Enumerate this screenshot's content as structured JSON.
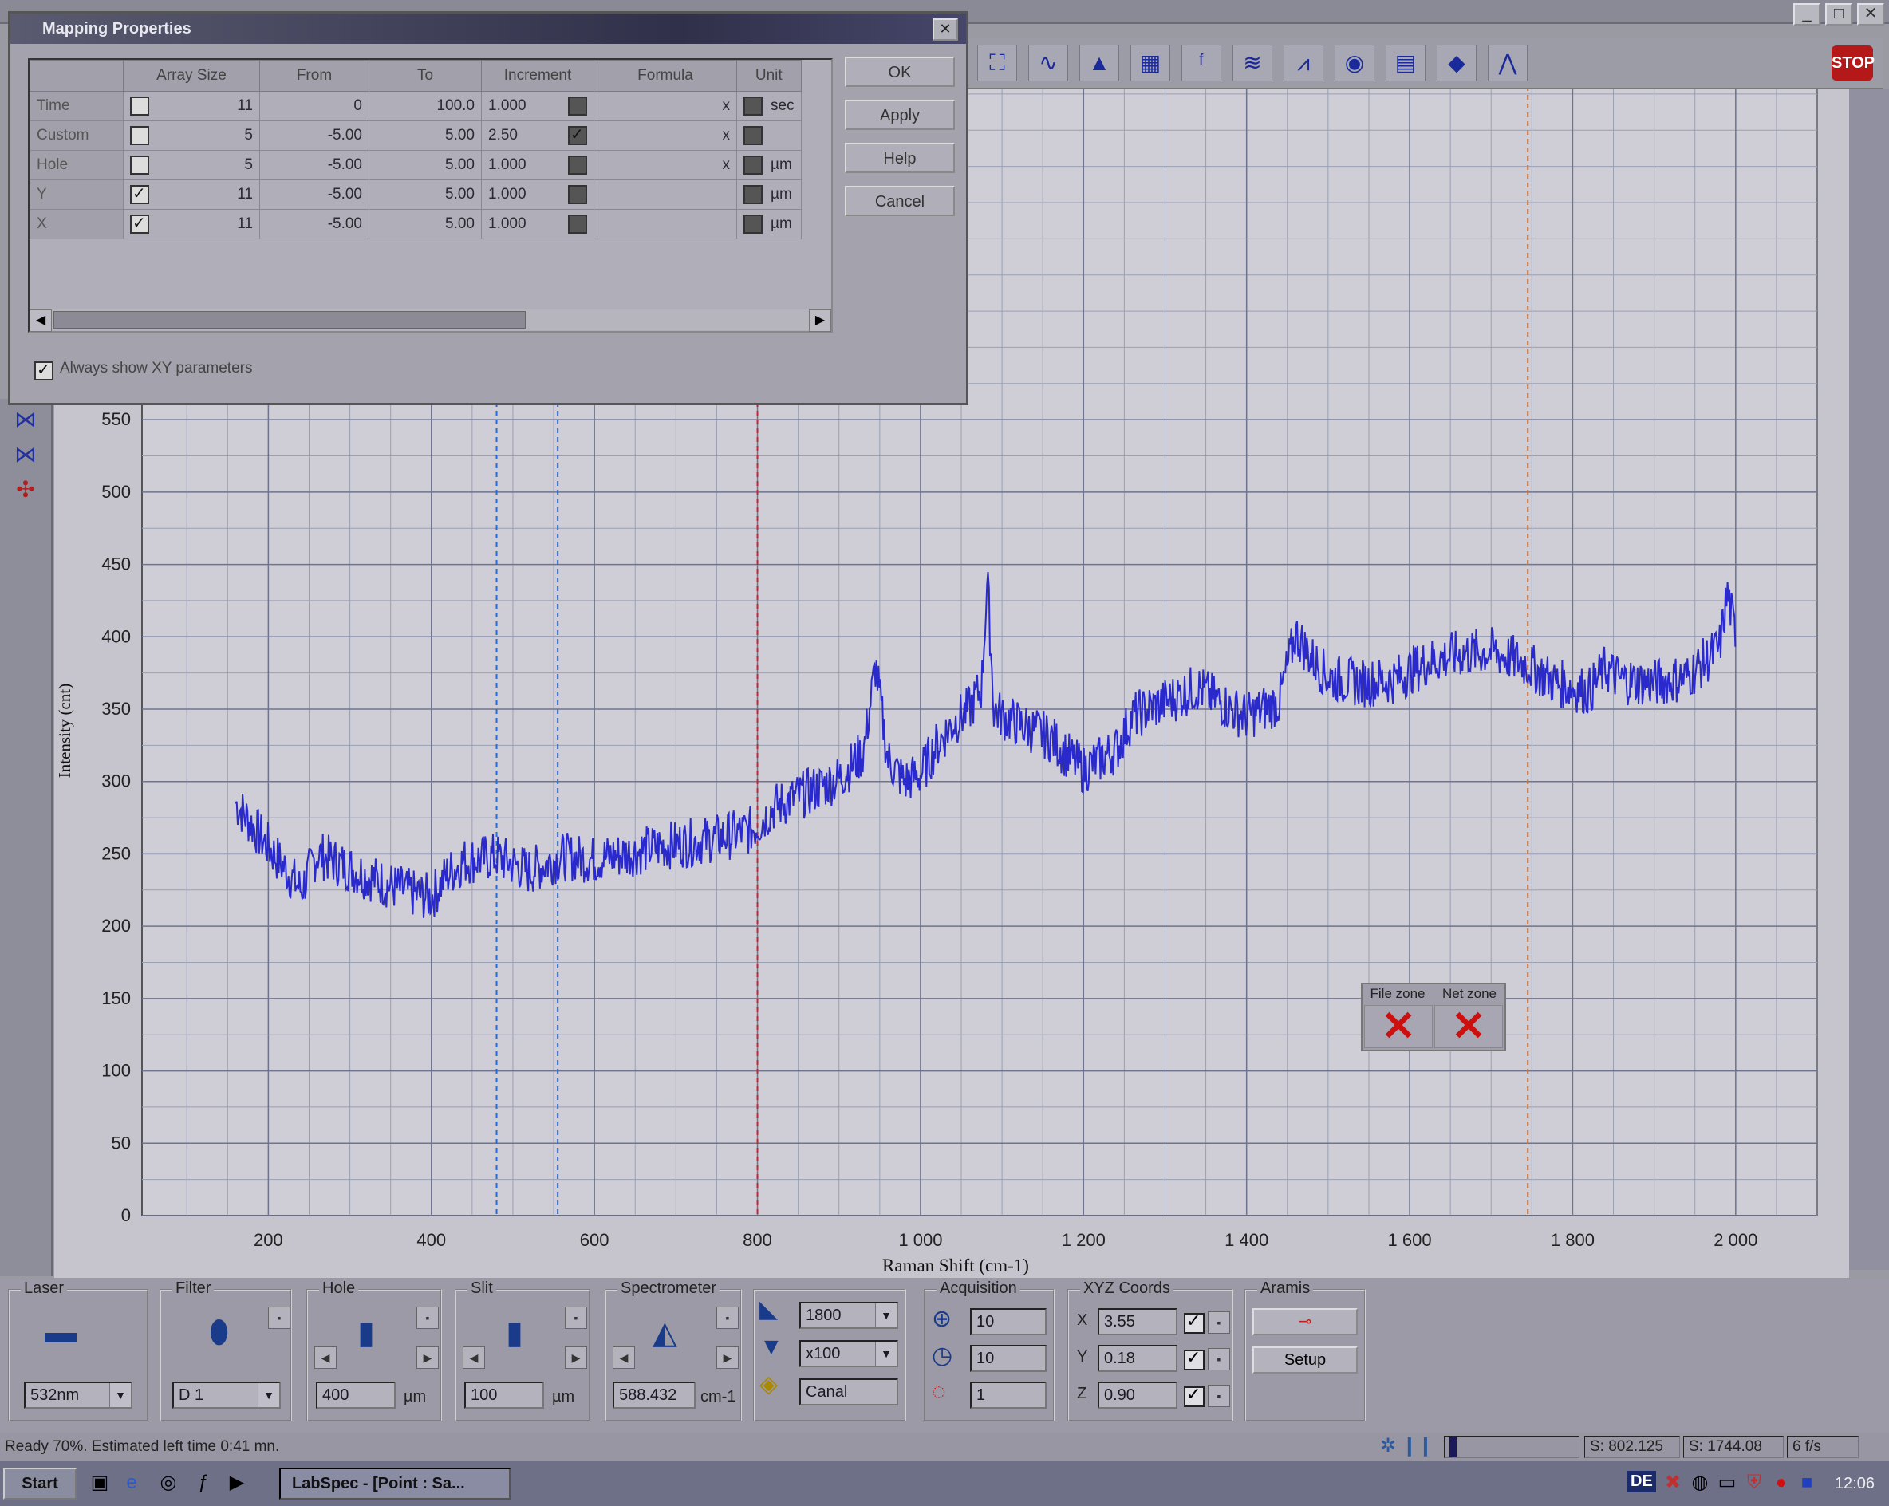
{
  "window": {
    "min": "_",
    "max": "□",
    "close": "✕"
  },
  "dialog": {
    "title": "Mapping Properties",
    "close": "✕",
    "columns": [
      "",
      "Array Size",
      "From",
      "To",
      "Increment",
      "Formula",
      "Unit"
    ],
    "rows": [
      {
        "name": "Time",
        "checked": false,
        "size": "11",
        "from": "0",
        "to": "100.0",
        "inc": "1.000",
        "inc_checked": false,
        "x": "x",
        "unit": "sec"
      },
      {
        "name": "Custom",
        "checked": false,
        "size": "5",
        "from": "-5.00",
        "to": "5.00",
        "inc": "2.50",
        "inc_checked": true,
        "x": "x",
        "unit": ""
      },
      {
        "name": "Hole",
        "checked": false,
        "size": "5",
        "from": "-5.00",
        "to": "5.00",
        "inc": "1.000",
        "inc_checked": false,
        "x": "x",
        "unit": "µm"
      },
      {
        "name": "Y",
        "checked": true,
        "size": "11",
        "from": "-5.00",
        "to": "5.00",
        "inc": "1.000",
        "inc_checked": false,
        "x": "",
        "unit": "µm"
      },
      {
        "name": "X",
        "checked": true,
        "size": "11",
        "from": "-5.00",
        "to": "5.00",
        "inc": "1.000",
        "inc_checked": false,
        "x": "",
        "unit": "µm"
      }
    ],
    "buttons": {
      "ok": "OK",
      "apply": "Apply",
      "help": "Help",
      "cancel": "Cancel"
    },
    "always_show": "Always show XY parameters"
  },
  "toolbar": {
    "stop": "STOP"
  },
  "chart_data": {
    "type": "line",
    "xlabel": "Raman Shift (cm-1)",
    "ylabel": "Intensity (cnt)",
    "xlim": [
      45,
      2100
    ],
    "ylim": [
      0,
      560
    ],
    "xticks": [
      200,
      400,
      600,
      800,
      1000,
      1200,
      1400,
      1600,
      1800,
      2000
    ],
    "xtick_labels": [
      "200",
      "400",
      "600",
      "800",
      "1 000",
      "1 200",
      "1 400",
      "1 600",
      "1 800",
      "2 000"
    ],
    "yticks": [
      0,
      50,
      100,
      150,
      200,
      250,
      300,
      350,
      400,
      450,
      500,
      550
    ],
    "grid": true,
    "markers": {
      "blue": [
        480,
        555
      ],
      "red": [
        800
      ],
      "orange": [
        1745
      ]
    },
    "series": [
      {
        "color": "#2a2acc",
        "x": [
          160,
          180,
          200,
          220,
          240,
          260,
          300,
          340,
          380,
          400,
          420,
          440,
          480,
          520,
          560,
          600,
          640,
          680,
          720,
          760,
          790,
          800,
          820,
          860,
          900,
          930,
          945,
          960,
          980,
          1000,
          1020,
          1040,
          1060,
          1075,
          1082,
          1090,
          1100,
          1120,
          1160,
          1180,
          1200,
          1240,
          1260,
          1300,
          1340,
          1380,
          1400,
          1440,
          1460,
          1480,
          1500,
          1540,
          1580,
          1620,
          1660,
          1700,
          1740,
          1780,
          1820,
          1840,
          1860,
          1900,
          1940,
          1960,
          1980,
          1990,
          2000
        ],
        "y": [
          285,
          270,
          255,
          240,
          225,
          250,
          240,
          230,
          222,
          220,
          236,
          245,
          248,
          238,
          248,
          246,
          250,
          255,
          258,
          262,
          266,
          270,
          282,
          292,
          302,
          320,
          380,
          315,
          300,
          305,
          325,
          340,
          350,
          365,
          440,
          350,
          345,
          340,
          330,
          318,
          308,
          322,
          345,
          355,
          365,
          350,
          345,
          355,
          402,
          385,
          372,
          368,
          370,
          382,
          388,
          390,
          382,
          368,
          362,
          378,
          370,
          368,
          372,
          382,
          392,
          430,
          400
        ]
      }
    ],
    "zones": {
      "file": "File zone",
      "net": "Net zone"
    }
  },
  "bottom": {
    "laser": {
      "label": "Laser",
      "value": "532nm"
    },
    "filter": {
      "label": "Filter",
      "value": "D 1"
    },
    "hole": {
      "label": "Hole",
      "value": "400",
      "unit": "µm"
    },
    "slit": {
      "label": "Slit",
      "value": "100",
      "unit": "µm"
    },
    "spectrometer": {
      "label": "Spectrometer",
      "value": "588.432",
      "unit": "cm-1"
    },
    "grating": {
      "value": "1800",
      "objective": "x100",
      "mode": "Canal"
    },
    "acquisition": {
      "label": "Acquisition",
      "accum": "10",
      "time": "10",
      "cycles": "1"
    },
    "xyz": {
      "label": "XYZ Coords",
      "x_label": "X",
      "x": "3.55",
      "y_label": "Y",
      "y": "0.18",
      "z_label": "Z",
      "z": "0.90"
    },
    "aramis": {
      "label": "Aramis",
      "setup": "Setup"
    }
  },
  "status": {
    "message": "Ready 70%. Estimated left time 0:41 mn.",
    "s1": "S: 802.125",
    "s2": "S: 1744.08",
    "fps": "6 f/s"
  },
  "taskbar": {
    "start": "Start",
    "app": "LabSpec - [Point : Sa...",
    "lang": "DE",
    "clock": "12:06"
  }
}
